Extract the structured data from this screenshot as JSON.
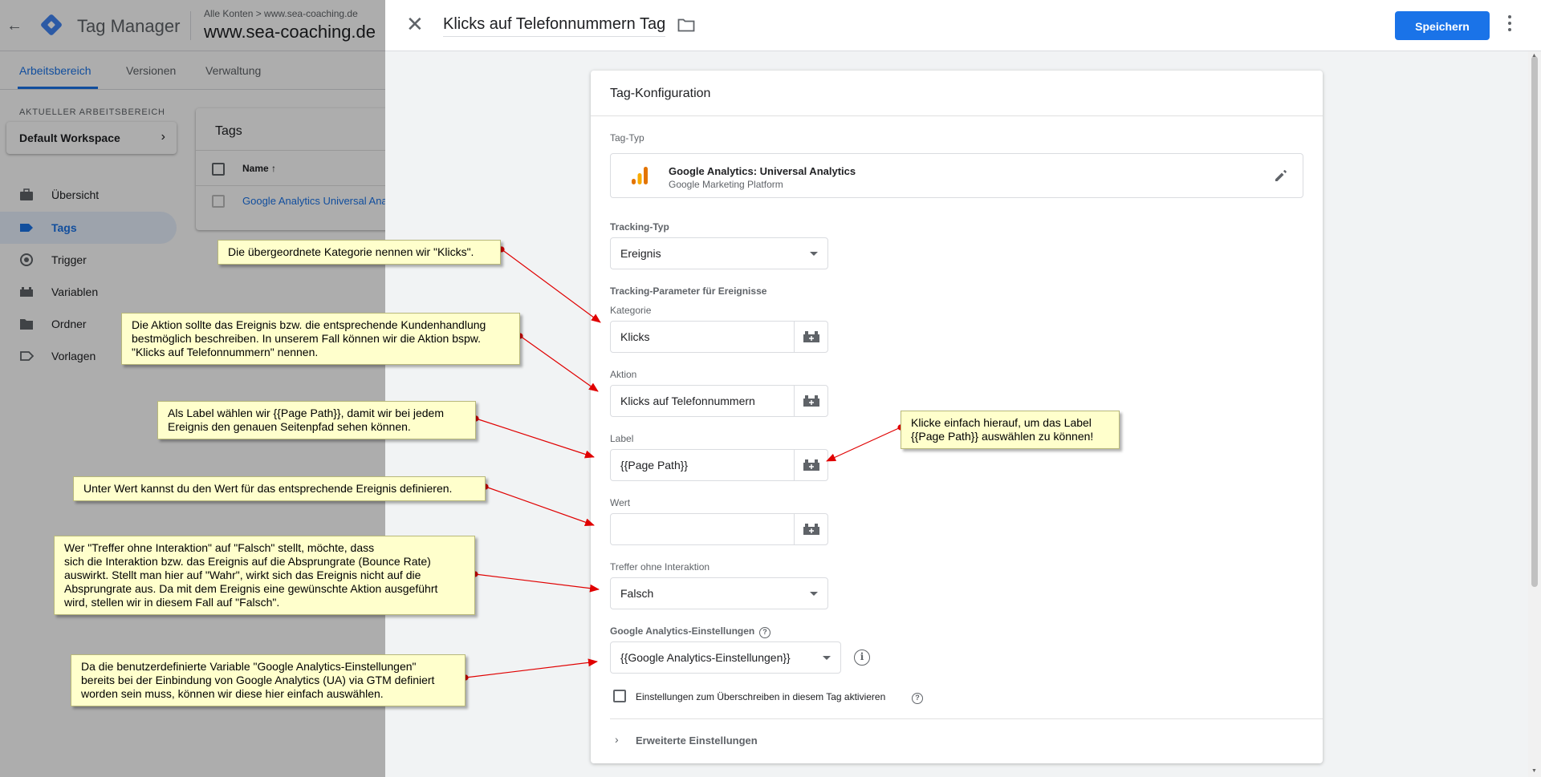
{
  "header": {
    "product_name": "Tag Manager",
    "breadcrumb": "Alle Konten > www.sea-coaching.de",
    "container_name": "www.sea-coaching.de"
  },
  "nav_tabs": [
    "Arbeitsbereich",
    "Versionen",
    "Verwaltung"
  ],
  "workspace": {
    "label": "AKTUELLER ARBEITSBEREICH",
    "name": "Default Workspace"
  },
  "sidebar": {
    "items": [
      {
        "label": "Übersicht",
        "icon": "briefcase-icon"
      },
      {
        "label": "Tags",
        "icon": "tag-icon",
        "active": true
      },
      {
        "label": "Trigger",
        "icon": "trigger-icon"
      },
      {
        "label": "Variablen",
        "icon": "variables-icon"
      },
      {
        "label": "Ordner",
        "icon": "folder-icon"
      },
      {
        "label": "Vorlagen",
        "icon": "template-icon"
      }
    ]
  },
  "tags_list": {
    "title": "Tags",
    "column_name": "Name",
    "rows": [
      "Google Analytics Universal Analytics"
    ]
  },
  "sheet": {
    "title": "Klicks auf Telefonnummern Tag",
    "save_label": "Speichern"
  },
  "config": {
    "title": "Tag-Konfiguration",
    "tag_type_label": "Tag-Typ",
    "tag_type_name": "Google Analytics: Universal Analytics",
    "tag_type_sub": "Google Marketing Platform",
    "tracking_type_label": "Tracking-Typ",
    "tracking_type_value": "Ereignis",
    "params_label": "Tracking-Parameter für Ereignisse",
    "category_label": "Kategorie",
    "category_value": "Klicks",
    "action_label": "Aktion",
    "action_value": "Klicks auf Telefonnummern",
    "label_label": "Label",
    "label_value": "{{Page Path}}",
    "value_label": "Wert",
    "value_value": "",
    "non_interaction_label": "Treffer ohne Interaktion",
    "non_interaction_value": "Falsch",
    "ga_settings_label": "Google Analytics-Einstellungen",
    "ga_settings_value": "{{Google Analytics-Einstellungen}}",
    "override_label": "Einstellungen zum Überschreiben in diesem Tag aktivieren",
    "advanced_label": "Erweiterte Einstellungen"
  },
  "annotations": {
    "category": "Die übergeordnete Kategorie nennen wir \"Klicks\".",
    "action": "Die Aktion sollte das Ereignis bzw. die entsprechende Kundenhandlung\nbestmöglich beschreiben. In unserem Fall können wir die Aktion bspw.\n\"Klicks auf Telefonnummern\" nennen.",
    "label": "Als Label wählen wir {{Page Path}}, damit wir bei jedem\nEreignis den genauen Seitenpfad sehen können.",
    "label_click": "Klicke einfach hierauf, um das Label\n{{Page Path}} auswählen zu können!",
    "value": "Unter Wert kannst du den Wert für das entsprechende Ereignis definieren.",
    "non_interaction": "Wer \"Treffer ohne Interaktion\" auf \"Falsch\" stellt, möchte, dass\nsich die Interaktion bzw. das Ereignis auf die Absprungrate (Bounce Rate)\nauswirkt. Stellt man hier auf \"Wahr\", wirkt sich das Ereignis nicht auf die\nAbsprungrate aus. Da mit dem Ereignis eine gewünschte Aktion ausgeführt\nwird, stellen wir in diesem Fall auf \"Falsch\".",
    "ga_settings": "Da die benutzerdefinierte Variable \"Google Analytics-Einstellungen\"\nbereits bei der Einbindung von Google Analytics (UA) via GTM definiert\nworden sein muss, können wir diese hier einfach auswählen."
  },
  "colors": {
    "accent": "#1a73e8",
    "annotation_bg": "#ffffcc",
    "arrow": "#e00000"
  }
}
